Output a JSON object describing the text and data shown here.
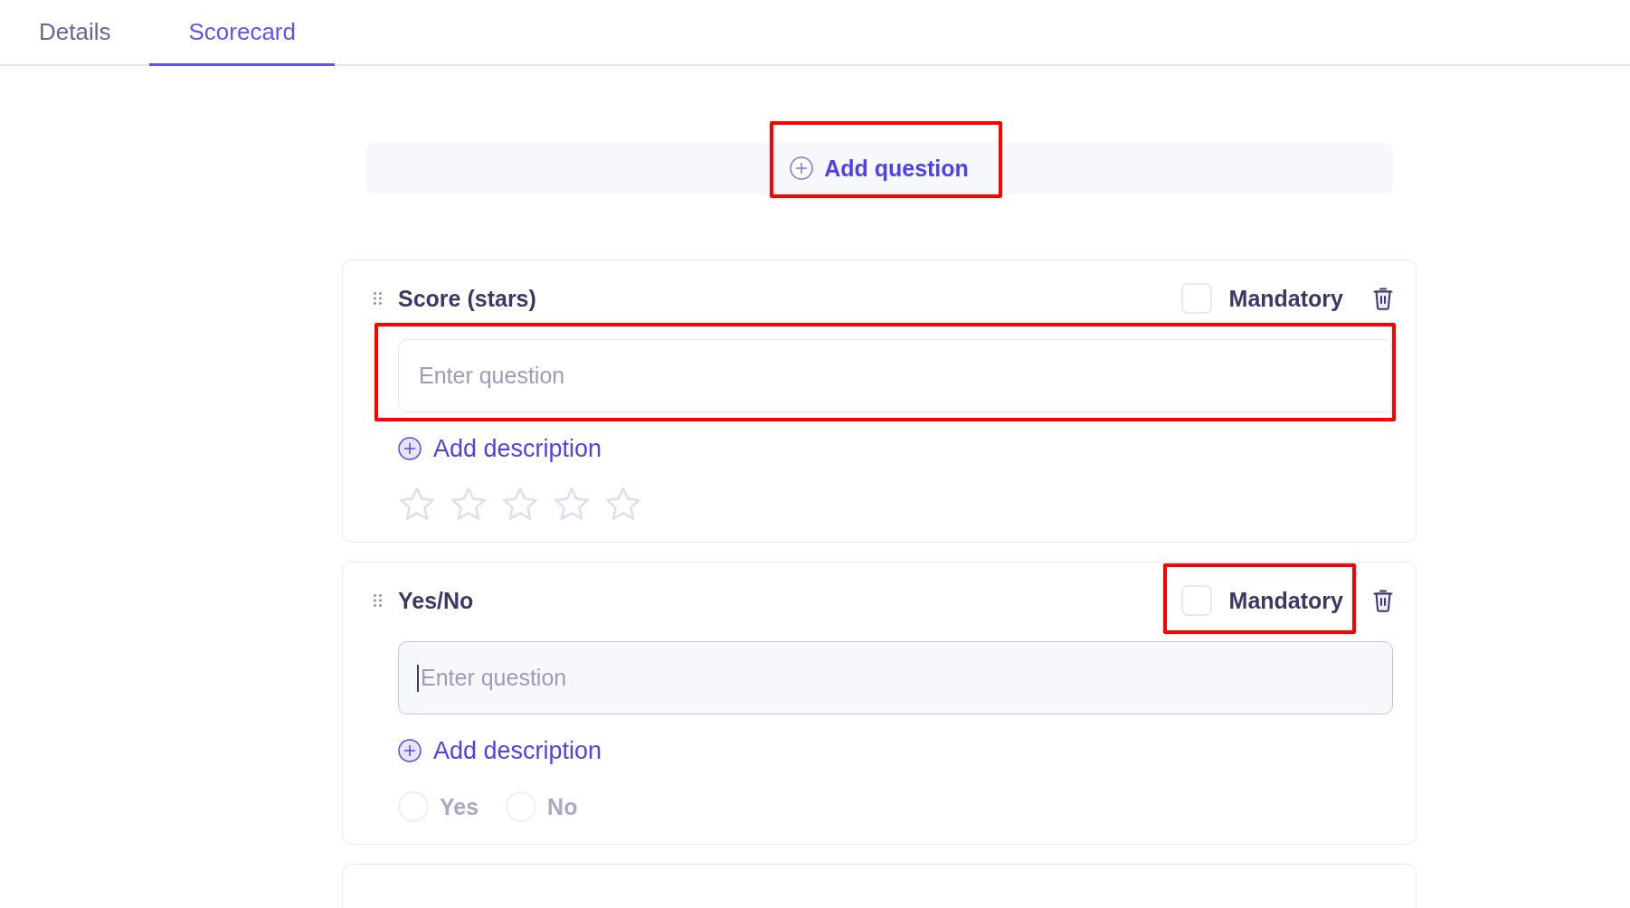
{
  "tabs": [
    {
      "label": "Details",
      "selected": false
    },
    {
      "label": "Scorecard",
      "selected": true
    }
  ],
  "add_question": {
    "label": "Add question",
    "highlighted": true
  },
  "questions": [
    {
      "kind": "stars",
      "title": "Score (stars)",
      "mandatory": {
        "label": "Mandatory",
        "checked": false,
        "highlighted": false
      },
      "input": {
        "placeholder": "Enter question",
        "focused": false,
        "highlighted": true
      },
      "add_description": "Add description",
      "stars": 0
    },
    {
      "kind": "yes_no",
      "title": "Yes/No",
      "mandatory": {
        "label": "Mandatory",
        "checked": false,
        "highlighted": true
      },
      "input": {
        "placeholder": "Enter question",
        "focused": true,
        "highlighted": false
      },
      "add_description": "Add description",
      "options": [
        {
          "label": "Yes",
          "selected": false
        },
        {
          "label": "No",
          "selected": false
        }
      ]
    },
    {
      "kind": "blank"
    }
  ]
}
